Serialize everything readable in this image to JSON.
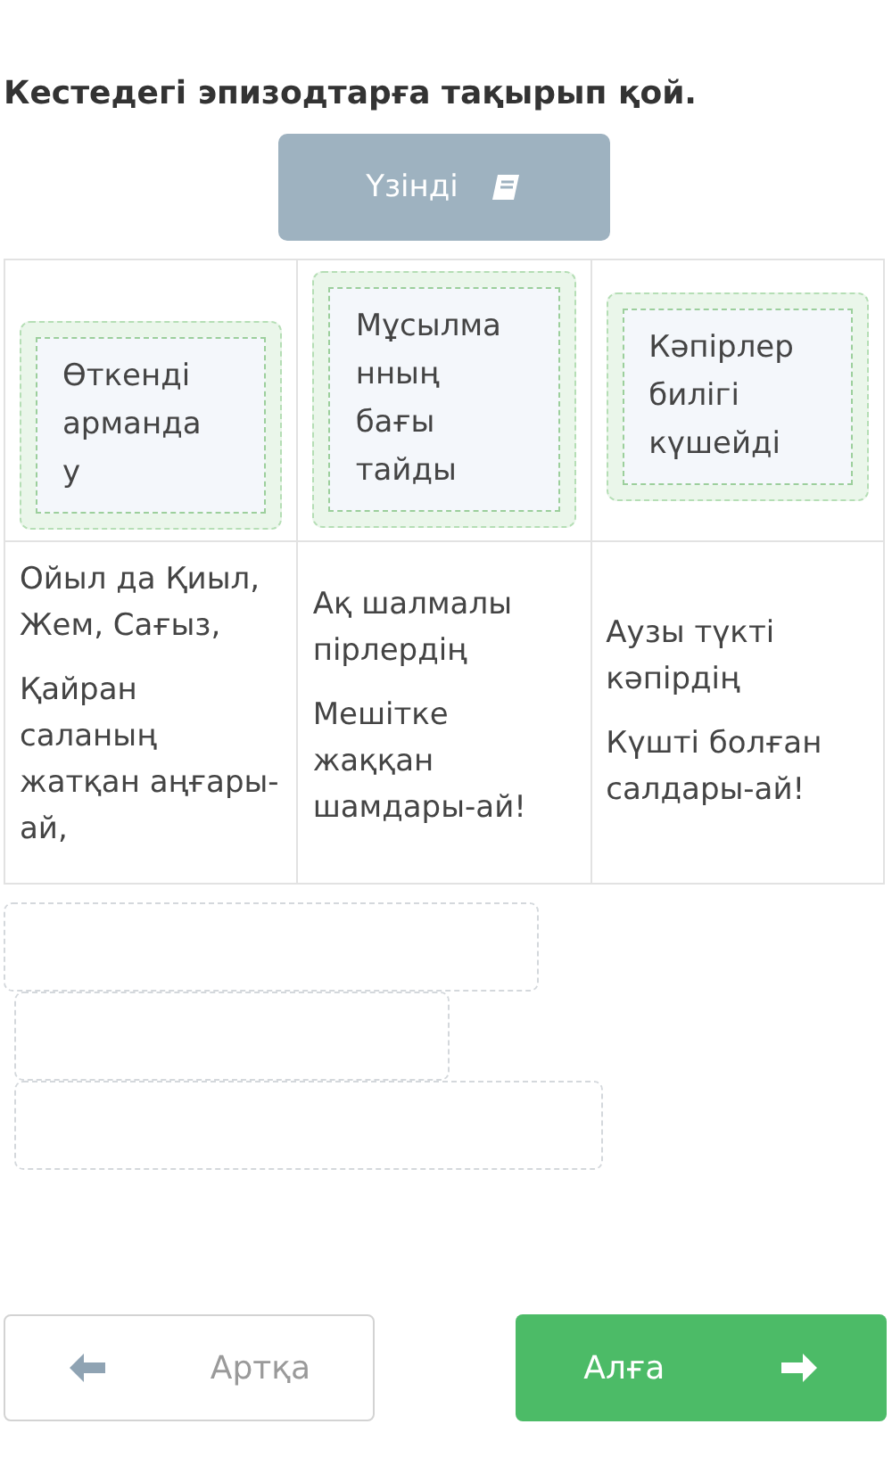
{
  "instruction": "Кестедегі эпизодтарға тақырып қой.",
  "source_button": {
    "label": "Үзінді"
  },
  "table": {
    "headers": [
      {
        "label": "Өткенді армандау"
      },
      {
        "label": "Мұсылманның бағы тайды"
      },
      {
        "label": "Кәпірлер билігі күшейді"
      }
    ],
    "cells": [
      {
        "stanzas": [
          "Ойыл да Қиыл, Жем, Сағыз,",
          "Қайран саланың жатқан аңғары-ай,"
        ]
      },
      {
        "stanzas": [
          "Ақ шалмалы пірлердің",
          "Мешітке жаққан шамдары-ай!"
        ]
      },
      {
        "stanzas": [
          "Аузы түкті кәпірдің",
          "Күшті болған салдары-ай!"
        ]
      }
    ]
  },
  "answer_slots": [
    {
      "filled": false
    },
    {
      "filled": false
    },
    {
      "filled": false
    }
  ],
  "nav": {
    "back": {
      "label": "Артқа"
    },
    "next": {
      "label": "Алға"
    }
  }
}
